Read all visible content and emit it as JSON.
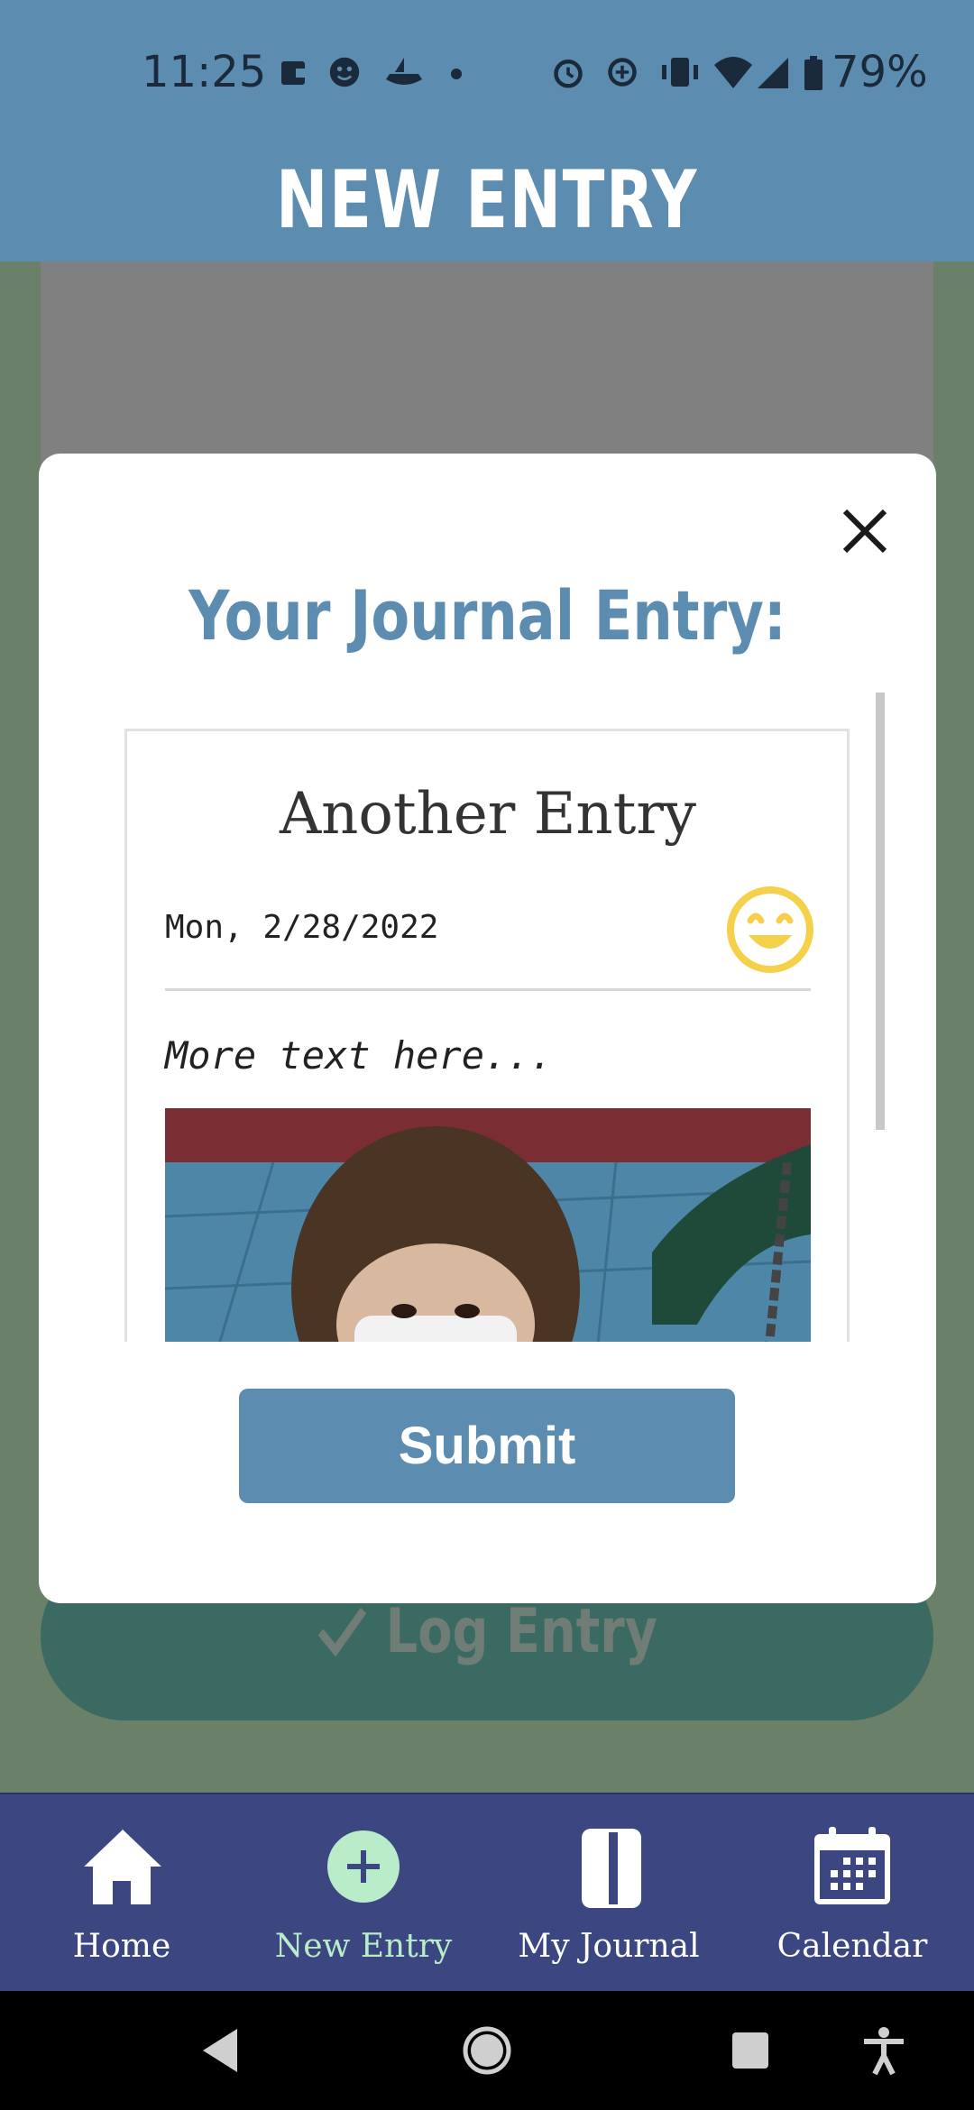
{
  "status_bar": {
    "time": "11:25",
    "battery_percent": "79%",
    "icons": [
      "wallet-icon",
      "face-icon",
      "boat-icon",
      "dot-icon",
      "alarm-icon",
      "data-saver-icon",
      "vibrate-icon",
      "wifi-icon",
      "signal-icon",
      "battery-icon"
    ]
  },
  "app_bar": {
    "title": "NEW ENTRY"
  },
  "background": {
    "log_entry_label": "Log Entry"
  },
  "modal": {
    "heading": "Your Journal Entry:",
    "entry": {
      "title": "Another Entry",
      "date": "Mon, 2/28/2022",
      "mood_icon": "smiling-face-icon",
      "body": "More text here..."
    },
    "submit_label": "Submit"
  },
  "bottom_nav": {
    "items": [
      {
        "label": "Home",
        "icon": "home-icon"
      },
      {
        "label": "New Entry",
        "icon": "plus-circle-icon",
        "active": true
      },
      {
        "label": "My Journal",
        "icon": "journal-icon"
      },
      {
        "label": "Calendar",
        "icon": "calendar-icon"
      }
    ]
  },
  "colors": {
    "primary": "#5c8cb0",
    "nav_bg": "#3c4680",
    "active_nav": "#b9ecc8",
    "mood_yellow": "#f5d04a"
  }
}
